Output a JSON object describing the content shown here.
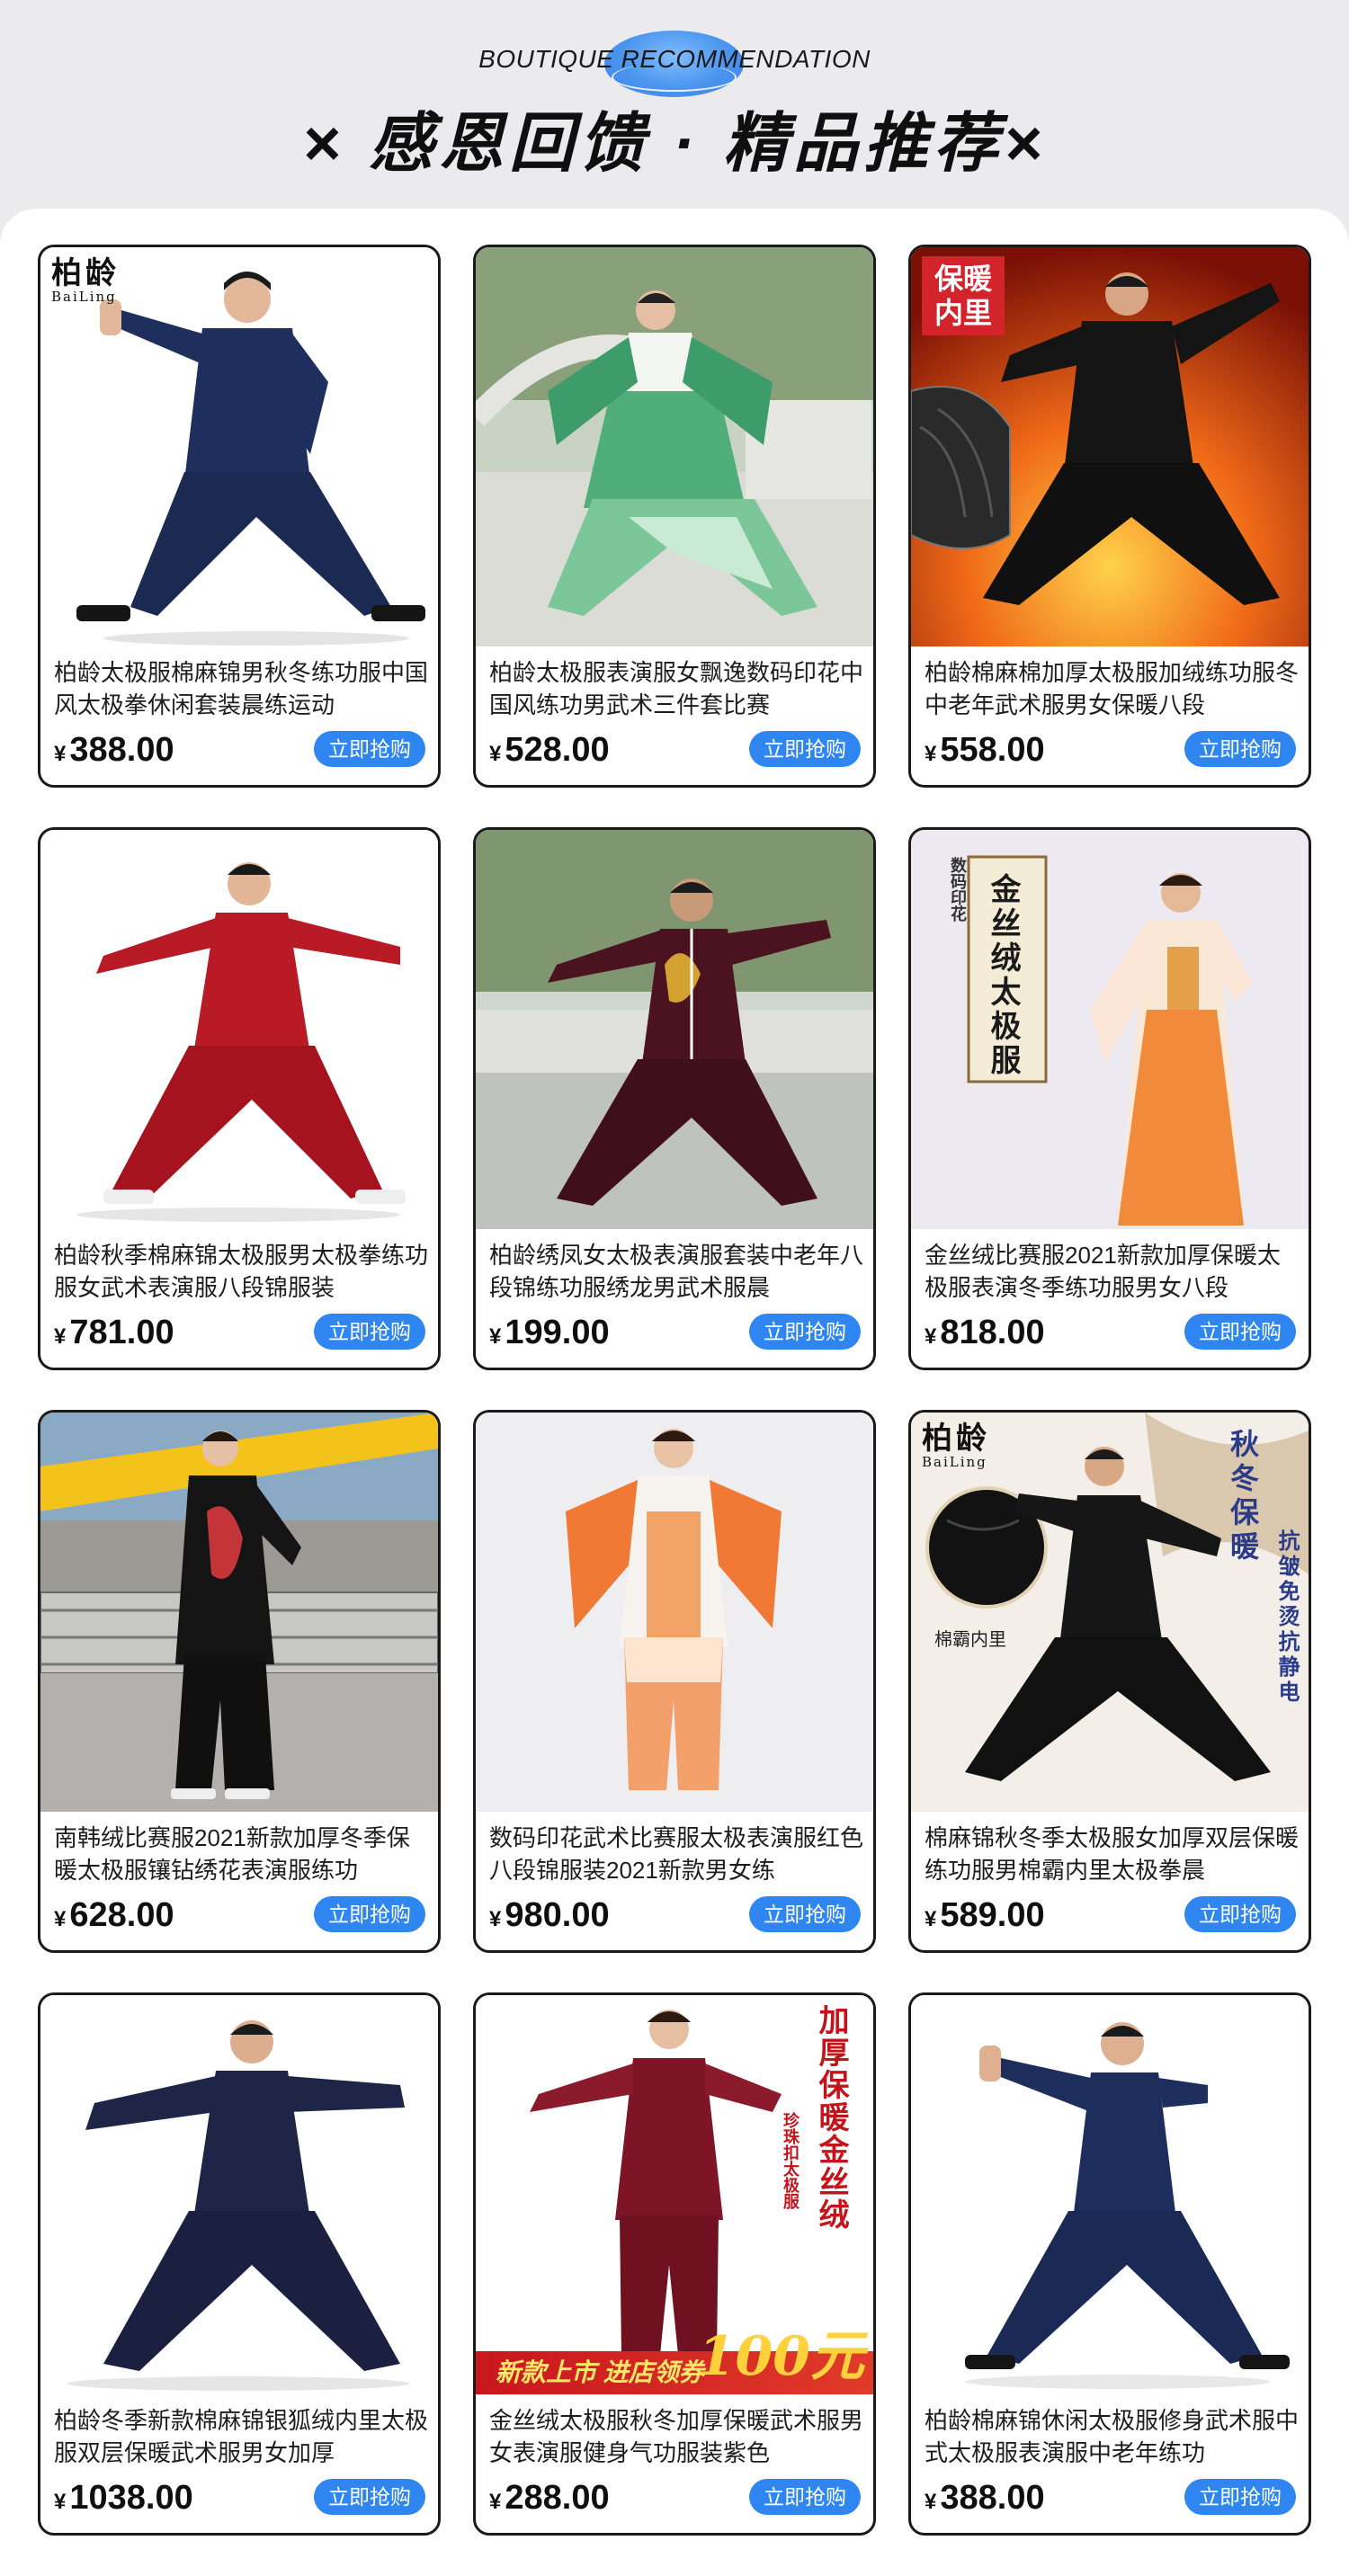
{
  "header": {
    "eng_title": "BOUTIQUE RECOMMENDATION",
    "main_title": "× 感恩回馈 · 精品推荐×"
  },
  "common": {
    "currency": "¥",
    "buy_label": "立即抢购",
    "accent": "#2f86f0"
  },
  "products": [
    {
      "title": "柏龄太极服棉麻锦男秋冬练功服中国风太极拳休闲套装晨练运动",
      "price": "388.00",
      "brand_zh": "柏龄",
      "brand_en": "BaiLing"
    },
    {
      "title": "柏龄太极服表演服女飘逸数码印花中国风练功男武术三件套比赛",
      "price": "528.00"
    },
    {
      "title": "柏龄棉麻棉加厚太极服加绒练功服冬中老年武术服男女保暖八段",
      "price": "558.00",
      "tag": "保暖内里"
    },
    {
      "title": "柏龄秋季棉麻锦太极服男太极拳练功服女武术表演服八段锦服装",
      "price": "781.00"
    },
    {
      "title": "柏龄绣凤女太极表演服套装中老年八段锦练功服绣龙男武术服晨",
      "price": "199.00"
    },
    {
      "title": "金丝绒比赛服2021新款加厚保暖太极服表演冬季练功服男女八段",
      "price": "818.00",
      "small_tag": "数码印花",
      "scroll_text": "金丝绒太极服"
    },
    {
      "title": "南韩绒比赛服2021新款加厚冬季保暖太极服镶钻绣花表演服练功",
      "price": "628.00"
    },
    {
      "title": "数码印花武术比赛服太极表演服红色八段锦服装2021新款男女练",
      "price": "980.00"
    },
    {
      "title": "棉麻锦秋冬季太极服女加厚双层保暖练功服男棉霸内里太极拳晨",
      "price": "589.00",
      "brand_zh": "柏龄",
      "brand_en": "BaiLing",
      "side_text": "秋冬保暖",
      "side_text2": "抗皱免烫抗静电",
      "inset_label": "棉霸内里"
    },
    {
      "title": "柏龄冬季新款棉麻锦银狐绒内里太极服双层保暖武术服男女加厚",
      "price": "1038.00"
    },
    {
      "title": "金丝绒太极服秋冬加厚保暖武术服男女表演服健身气功服装紫色",
      "price": "288.00",
      "side_text": "加厚保暖金丝绒",
      "side_small": "珍珠扣太极服",
      "promo": "新款上市 进店领券",
      "promo_num": "100元"
    },
    {
      "title": "柏龄棉麻锦休闲太极服修身武术服中式太极服表演服中老年练功",
      "price": "388.00"
    }
  ]
}
